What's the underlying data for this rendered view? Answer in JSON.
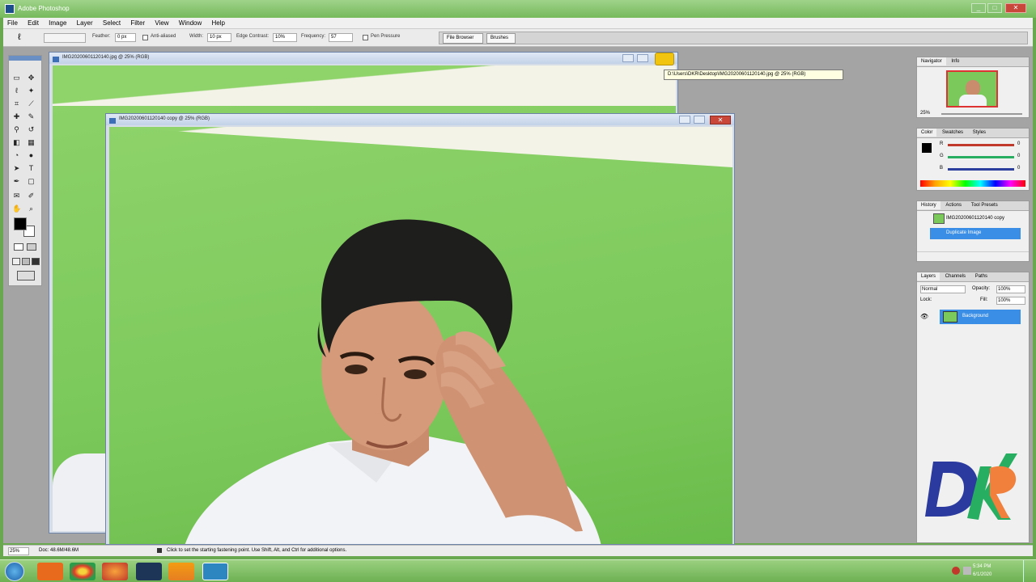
{
  "app": {
    "title": "Adobe Photoshop",
    "window_buttons": [
      "_",
      "□",
      "✕"
    ]
  },
  "menu": [
    "File",
    "Edit",
    "Image",
    "Layer",
    "Select",
    "Filter",
    "View",
    "Window",
    "Help"
  ],
  "options_bar": {
    "feather_label": "Feather:",
    "feather_value": "0 px",
    "antialiased_label": "Anti-aliased",
    "width_label": "Width:",
    "width_value": "10 px",
    "edge_contrast_label": "Edge Contrast:",
    "edge_contrast_value": "10%",
    "frequency_label": "Frequency:",
    "frequency_value": "57",
    "pen_pressure_label": "Pen Pressure",
    "well_tabs": [
      "File Browser",
      "Brushes"
    ]
  },
  "documents": [
    {
      "title": "IMG20200601120140.jpg @ 25% (RGB)"
    },
    {
      "title": "IMG20200601120140 copy @ 25% (RGB)"
    }
  ],
  "tooltip": "D:\\Users\\DKR\\Desktop\\IMG20200601120140.jpg @ 25% (RGB)",
  "palettes": {
    "navigator_tabs": [
      "Navigator",
      "Info"
    ],
    "navigator_zoom": "25%",
    "color_tabs": [
      "Color",
      "Swatches",
      "Styles"
    ],
    "color_channels": [
      {
        "label": "R",
        "value": "0",
        "color": "#c0392b"
      },
      {
        "label": "G",
        "value": "0",
        "color": "#27ae60"
      },
      {
        "label": "B",
        "value": "0",
        "color": "#2c3e9e"
      }
    ],
    "history_tabs": [
      "History",
      "Actions",
      "Tool Presets"
    ],
    "history_items": [
      "IMG20200601120140 copy",
      "Duplicate Image"
    ],
    "layers_tabs": [
      "Layers",
      "Channels",
      "Paths"
    ],
    "layers_blend": "Normal",
    "layers_opacity_label": "Opacity:",
    "layers_opacity": "100%",
    "layers_fill_label": "Fill:",
    "layers_fill": "100%",
    "layers_lock_label": "Lock:",
    "layers": [
      "Background"
    ]
  },
  "status": {
    "zoom": "25%",
    "doc_size": "Doc: 48.6M/48.6M",
    "hint": "Click to set the starting fastening point. Use Shift, Alt, and Ctrl for additional options."
  },
  "taskbar": {
    "time": "5:34 PM",
    "date": "6/1/2020"
  },
  "colors": {
    "accent": "#3a8ee6",
    "green_screen": "#7cc95b",
    "titlebar": "#76b95c"
  }
}
